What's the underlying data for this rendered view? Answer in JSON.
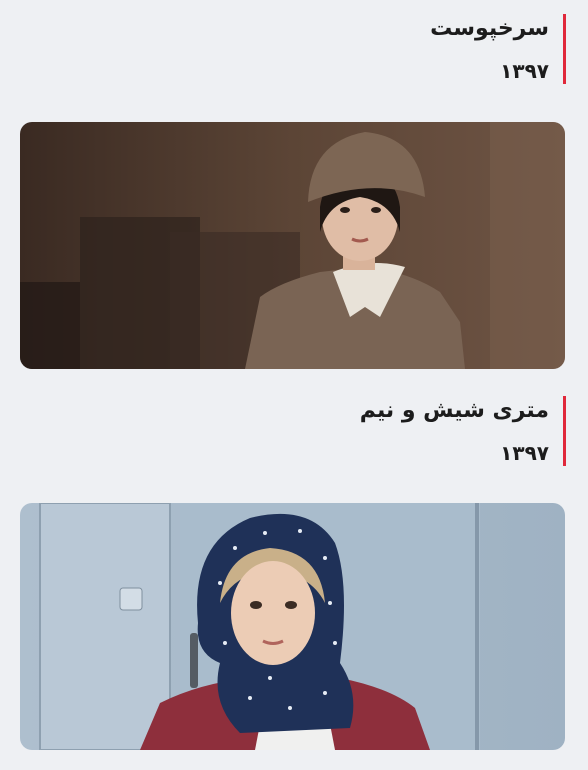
{
  "films": [
    {
      "title": "سرخپوست",
      "year": "۱۳۹۷",
      "poster_icon": "film-still-woman-in-beret"
    },
    {
      "title": "متری شیش و نیم",
      "year": "۱۳۹۷",
      "poster_icon": "film-still-woman-in-headscarf"
    }
  ],
  "colors": {
    "accent": "#e0283a",
    "background": "#eef0f3",
    "text": "#1c1c1c"
  }
}
